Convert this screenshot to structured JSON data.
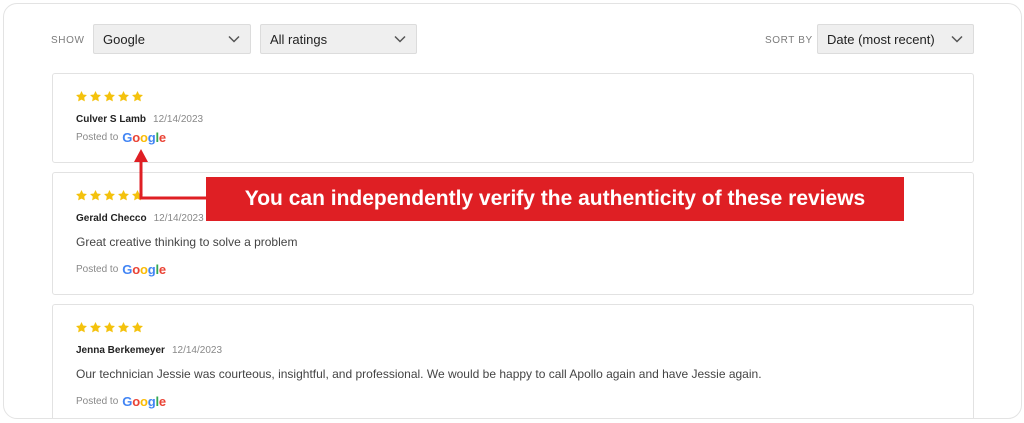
{
  "filters": {
    "show_label": "SHOW",
    "source_select": "Google",
    "rating_select": "All ratings",
    "sort_label": "SORT BY",
    "sort_select": "Date (most recent)"
  },
  "reviews": [
    {
      "rating": 5,
      "author": "Culver S Lamb",
      "date": "12/14/2023",
      "text": "",
      "posted_to": "Posted to",
      "platform": "Google"
    },
    {
      "rating": 5,
      "author": "Gerald Checco",
      "date": "12/14/2023",
      "text": "Great creative thinking to solve a problem",
      "posted_to": "Posted to",
      "platform": "Google"
    },
    {
      "rating": 5,
      "author": "Jenna Berkemeyer",
      "date": "12/14/2023",
      "text": "Our technician Jessie was courteous, insightful, and professional. We would be happy to call Apollo again and have Jessie again.",
      "posted_to": "Posted to",
      "platform": "Google"
    }
  ],
  "callout": {
    "text": "You can independently verify the authenticity of these reviews"
  },
  "colors": {
    "star": "#f4c20d",
    "callout_bg": "#df1f24",
    "google_blue": "#4285f4",
    "google_red": "#ea4335",
    "google_yellow": "#fbbc05",
    "google_green": "#34a853"
  },
  "icons": {
    "star": "star-icon",
    "dropdown": "chevron-down-icon"
  }
}
